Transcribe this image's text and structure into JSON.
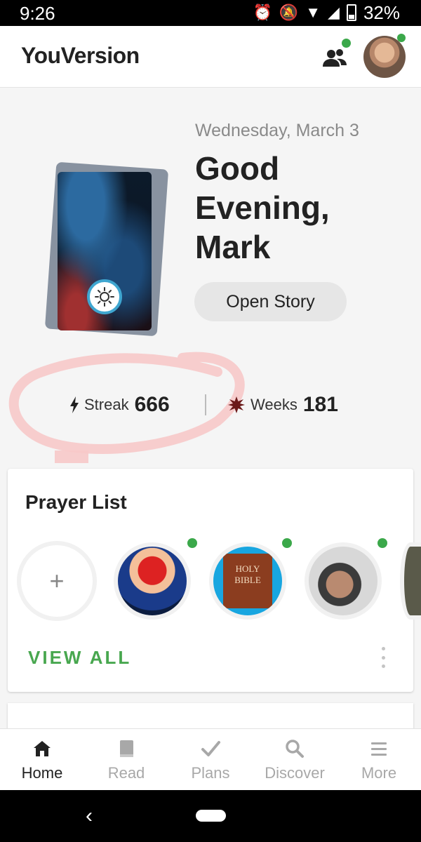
{
  "status_bar": {
    "time": "9:26",
    "battery": "32%"
  },
  "app": {
    "name": "YouVersion"
  },
  "hero": {
    "date": "Wednesday, March 3",
    "greeting": "Good Evening, Mark",
    "open_story_label": "Open Story"
  },
  "stats": {
    "streak_label": "Streak",
    "streak_value": "666",
    "weeks_label": "Weeks",
    "weeks_value": "181"
  },
  "prayer_list": {
    "title": "Prayer List",
    "add_symbol": "+",
    "view_all_label": "VIEW ALL",
    "avatar_badge_text": "HOLY BIBLE"
  },
  "bottom_nav": {
    "items": [
      {
        "label": "Home",
        "icon": "home-icon",
        "active": true
      },
      {
        "label": "Read",
        "icon": "book-icon",
        "active": false
      },
      {
        "label": "Plans",
        "icon": "check-icon",
        "active": false
      },
      {
        "label": "Discover",
        "icon": "search-icon",
        "active": false
      },
      {
        "label": "More",
        "icon": "menu-icon",
        "active": false
      }
    ]
  },
  "colors": {
    "accent_green": "#48a74f",
    "online_dot": "#3ba84a"
  }
}
